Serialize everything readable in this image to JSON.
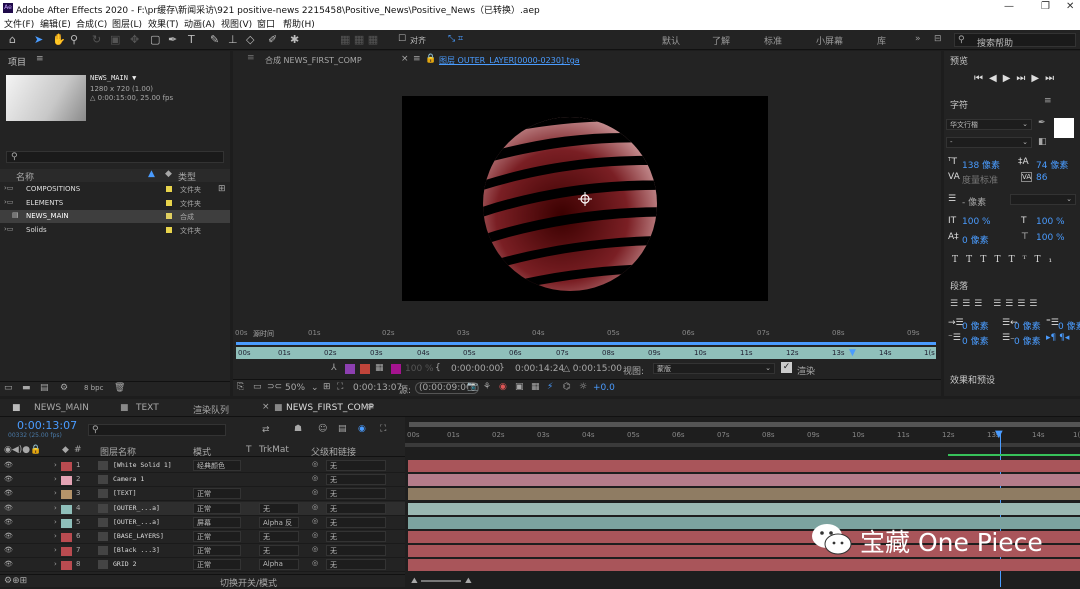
{
  "window": {
    "title": "Adobe After Effects 2020 - F:\\pr缓存\\新闻采访\\921 positive-news 2215458\\Positive_News\\Positive_News（已转换）.aep",
    "controls": [
      "—",
      "❐",
      "✕"
    ]
  },
  "menu": [
    "文件(F)",
    "编辑(E)",
    "合成(C)",
    "图层(L)",
    "效果(T)",
    "动画(A)",
    "视图(V)",
    "窗口",
    "帮助(H)"
  ],
  "toolbar": {
    "snap_label": "对齐",
    "workspaces": [
      "默认",
      "了解",
      "标准",
      "小屏幕",
      "库"
    ],
    "search_placeholder": "搜索帮助"
  },
  "project": {
    "title": "项目",
    "comp_name": "NEWS_MAIN ▼",
    "comp_info": [
      "1280 x 720 (1.00)",
      "△ 0:00:15:00, 25.00 fps"
    ],
    "col_name": "名称",
    "col_type": "类型",
    "items": [
      {
        "name": "COMPOSITIONS",
        "type": "文件夹"
      },
      {
        "name": "ELEMENTS",
        "type": "文件夹"
      },
      {
        "name": "NEWS_MAIN",
        "type": "合成"
      },
      {
        "name": "Solids",
        "type": "文件夹"
      }
    ],
    "bpc": "8 bpc"
  },
  "viewer": {
    "tab_comp": "合成 NEWS_FIRST_COMP",
    "tab_layer": "图层 OUTER_LAYER[0000-0230].tga",
    "source_time_label": "源时间",
    "ruler": [
      "00s",
      "01s",
      "02s",
      "03s",
      "04s",
      "05s",
      "06s",
      "07s",
      "08s",
      "09s"
    ],
    "inner_ruler": [
      "00s",
      "01s",
      "02s",
      "03s",
      "04s",
      "05s",
      "06s",
      "07s",
      "08s",
      "09s",
      "10s",
      "11s",
      "12s",
      "13s",
      "14s",
      "1(s"
    ],
    "in_time": "0:00:00:00",
    "out_time": "0:00:14:24",
    "duration": "△ 0:00:15:00",
    "view_label": "视图:",
    "view_value": "蒙版",
    "render_label": "渲染",
    "zoom": "50%",
    "current_time": "0:00:13:07",
    "delta": "(0:00:09:06)",
    "opacity": "100 %",
    "exposure": "+0.0"
  },
  "right": {
    "preview": "预览",
    "character": "字符",
    "font": "华文行楷",
    "font_style": "-",
    "size": "138 像素",
    "leading": "74 像素",
    "kerning": "度量标准",
    "tracking": "86",
    "stroke": "- 像素",
    "vscale": "100 %",
    "hscale": "100 %",
    "baseline": "0 像素",
    "tsume": "100 %",
    "paragraph": "段落",
    "indent": [
      "0 像素",
      "0 像素",
      "0 像素",
      "0 像素",
      "0 像素"
    ],
    "effects": "效果和预设"
  },
  "timeline": {
    "tabs": [
      "NEWS_MAIN",
      "TEXT",
      "渲染队列",
      "NEWS_FIRST_COMP"
    ],
    "time": "0:00:13:07",
    "fps": "00332 (25.00 fps)",
    "cols": {
      "name": "图层名称",
      "mode": "模式",
      "t": "T",
      "trkmat": "TrkMat",
      "parent": "父级和链接"
    },
    "ruler": [
      "00s",
      "01s",
      "02s",
      "03s",
      "04s",
      "05s",
      "06s",
      "07s",
      "08s",
      "09s",
      "10s",
      "11s",
      "12s",
      "13s",
      "14s",
      "1("
    ],
    "layers": [
      {
        "num": "1",
        "name": "[White Solid 1]",
        "mode": "经典颜色",
        "trk": "",
        "parent": "无",
        "color": "#b94b50",
        "bar": "#a9555a"
      },
      {
        "num": "2",
        "name": "Camera 1",
        "mode": "",
        "trk": "",
        "parent": "无",
        "color": "#e4a3b4",
        "bar": "#b47c8a"
      },
      {
        "num": "3",
        "name": "[TEXT]",
        "mode": "正常",
        "trk": "",
        "parent": "无",
        "color": "#b5946a",
        "bar": "#8f7c63"
      },
      {
        "num": "4",
        "name": "[OUTER_...a]",
        "mode": "正常",
        "trk": "无",
        "parent": "无",
        "color": "#8fbfba",
        "bar": "#9ab8b2"
      },
      {
        "num": "5",
        "name": "[OUTER_...a]",
        "mode": "屏幕",
        "trk": "Alpha 反",
        "parent": "无",
        "color": "#8fbfba",
        "bar": "#7ca39f"
      },
      {
        "num": "6",
        "name": "[BASE_LAYERS]",
        "mode": "正常",
        "trk": "无",
        "parent": "无",
        "color": "#b94b50",
        "bar": "#a9555a"
      },
      {
        "num": "7",
        "name": "[Black ...3]",
        "mode": "正常",
        "trk": "无",
        "parent": "无",
        "color": "#b94b50",
        "bar": "#a9555a"
      },
      {
        "num": "8",
        "name": "GRID 2",
        "mode": "正常",
        "trk": "Alpha",
        "parent": "无",
        "color": "#b94b50",
        "bar": "#a9555a"
      }
    ],
    "footer": "切换开关/模式"
  },
  "watermark": "宝藏 One Piece"
}
